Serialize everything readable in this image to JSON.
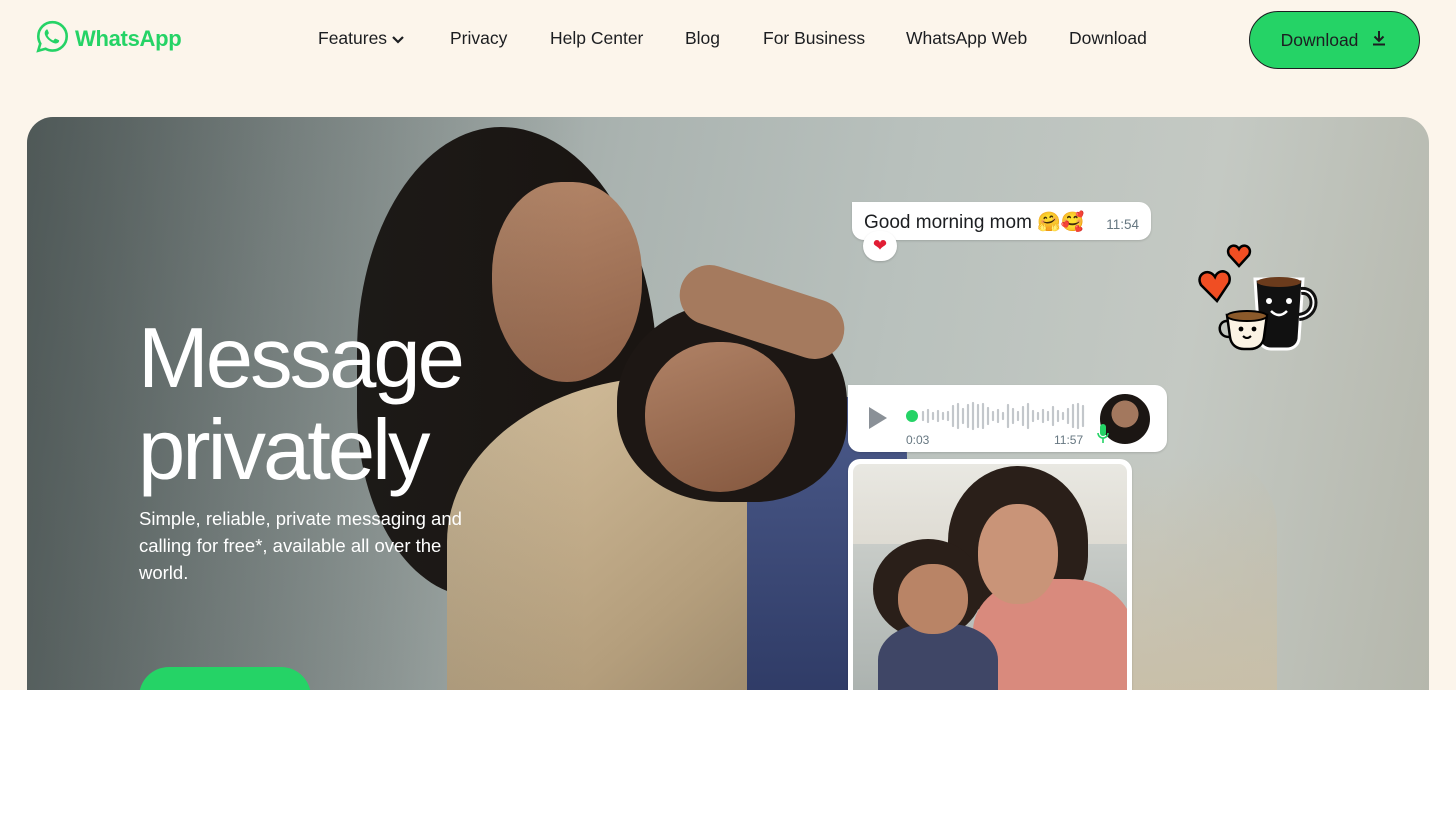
{
  "brand": {
    "name": "WhatsApp",
    "color": "#25d366",
    "icon": "whatsapp-logo-icon"
  },
  "nav": {
    "items": [
      {
        "label": "Features",
        "has_dropdown": true
      },
      {
        "label": "Privacy"
      },
      {
        "label": "Help Center"
      },
      {
        "label": "Blog"
      },
      {
        "label": "For Business"
      },
      {
        "label": "WhatsApp Web"
      },
      {
        "label": "Download"
      }
    ],
    "download_button": {
      "label": "Download",
      "icon": "download-icon"
    }
  },
  "hero": {
    "title_line1": "Message",
    "title_line2": "privately",
    "subtitle": "Simple, reliable, private messaging and calling for free*, available all over the world.",
    "message_bubble": {
      "text": "Good morning mom 🤗🥰",
      "time": "11:54",
      "reaction": "❤"
    },
    "voice_note": {
      "elapsed": "0:03",
      "time": "11:57",
      "icon": "play-icon",
      "mic_icon": "mic-icon"
    },
    "sticker": "coffee-cups-hearts-sticker"
  },
  "colors": {
    "background": "#fcf5eb",
    "accent": "#25d366",
    "text": "#1c1e21",
    "timestamp": "#667781"
  }
}
